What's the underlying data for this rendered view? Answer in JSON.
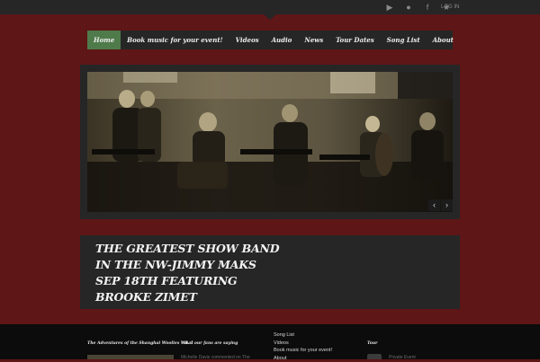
{
  "topbar": {
    "social_icons": [
      {
        "name": "youtube-icon",
        "glyph": "▶"
      },
      {
        "name": "apple-icon",
        "glyph": "●"
      },
      {
        "name": "facebook-icon",
        "glyph": "f"
      },
      {
        "name": "star-icon",
        "glyph": "★"
      }
    ],
    "login_label": "LOG IN"
  },
  "nav": {
    "items": [
      {
        "label": "Home",
        "active": true
      },
      {
        "label": "Book music for your event!",
        "active": false
      },
      {
        "label": "Videos",
        "active": false
      },
      {
        "label": "Audio",
        "active": false
      },
      {
        "label": "News",
        "active": false
      },
      {
        "label": "Tour Dates",
        "active": false
      },
      {
        "label": "Song List",
        "active": false
      },
      {
        "label": "About",
        "active": false
      }
    ]
  },
  "slider": {
    "prev_glyph": "‹",
    "next_glyph": "›"
  },
  "headline": {
    "title": "The Greatest Show Band in the NW-Jimmy Maks Sep 18th featuring Brooke Zimet"
  },
  "footer": {
    "col1_title": "The Adventures of the Shanghai Woolies Vol. 1",
    "col2_title": "What our fans are saying",
    "col2_text": "Michelle Davis commented on The",
    "links": [
      "Song List",
      "Videos",
      "Book music for your event!",
      "About"
    ],
    "col4_title": "Tour",
    "col4_text": "Private Event"
  },
  "colors": {
    "background": "#5e1616",
    "panel": "#262626",
    "active_nav": "#4f7a4a",
    "footer": "#0c0c0c"
  }
}
